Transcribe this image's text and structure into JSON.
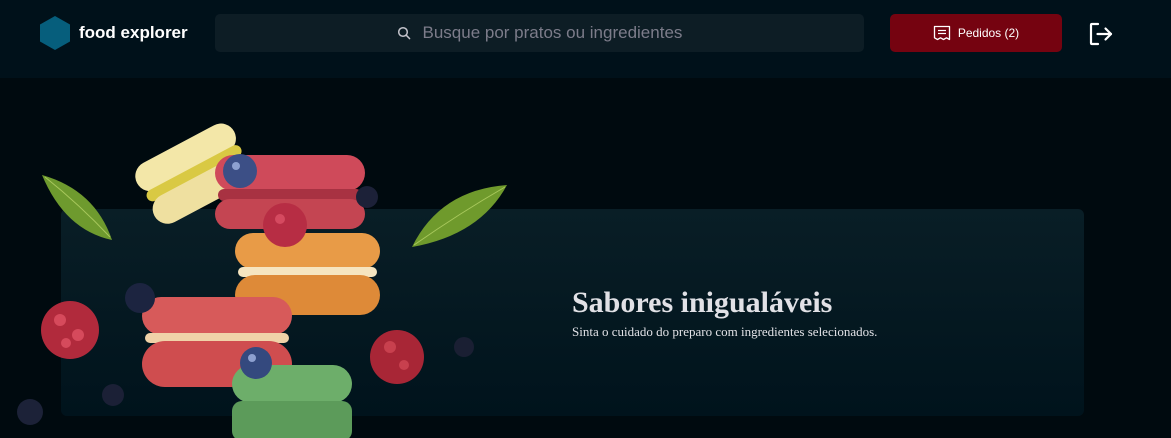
{
  "header": {
    "brand": "food explorer",
    "search": {
      "placeholder": "Busque por pratos ou ingredientes"
    },
    "orders_button": {
      "label": "Pedidos (2)"
    },
    "logout": {
      "icon": "sign-out-icon"
    }
  },
  "banner": {
    "title": "Sabores inigualáveis",
    "subtitle": "Sinta o cuidado do preparo com ingredientes selecionados.",
    "image": "macarons-image"
  },
  "colors": {
    "page_background": "#000a0f",
    "header_background": "#00111a",
    "search_background": "#0d1d25",
    "accent_red": "#750310",
    "logo_blue": "#065e7c",
    "banner_gradient_top": "#091e26",
    "banner_gradient_bottom": "#00131c",
    "text_light": "#e1e1e6",
    "text_muted": "#7c7c8a"
  }
}
